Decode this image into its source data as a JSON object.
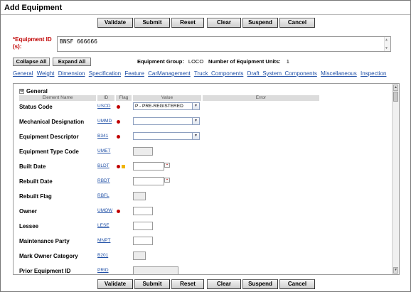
{
  "window": {
    "title": "Add Equipment"
  },
  "toolbar": {
    "validate": "Validate",
    "submit": "Submit",
    "reset": "Reset",
    "clear": "Clear",
    "suspend": "Suspend",
    "cancel": "Cancel"
  },
  "equipment_id": {
    "label_line1": "*Equipment ID",
    "label_line2": "(s):",
    "value": "BNSF 666666"
  },
  "controls": {
    "collapse_all": "Collapse All",
    "expand_all": "Expand All",
    "equipment_group_label": "Equipment Group:",
    "equipment_group_value": "LOCO",
    "units_label": "Number of Equipment Units:",
    "units_value": "1"
  },
  "section_links": [
    "General",
    "Weight",
    "Dimension",
    "Specification",
    "Feature",
    "CarManagement",
    "Truck_Components",
    "Draft_System_Components",
    "Miscellaneous",
    "Inspection"
  ],
  "section": {
    "toggle_symbol": "⊖",
    "title": "General",
    "columns": {
      "element": "Element Name",
      "id": "ID",
      "flag": "Flag",
      "value": "Value",
      "error": "Error"
    }
  },
  "rows": [
    {
      "label": "Status Code",
      "id": "USCD",
      "value": "P - PRE-REGISTERED"
    },
    {
      "label": "Mechanical Designation",
      "id": "UMMD",
      "value": ""
    },
    {
      "label": "Equipment Descriptor",
      "id": "B341",
      "value": ""
    },
    {
      "label": "Equipment Type Code",
      "id": "UMET",
      "value": ""
    },
    {
      "label": "Built Date",
      "id": "BLDT",
      "value": ""
    },
    {
      "label": "Rebuilt Date",
      "id": "RBDT",
      "value": ""
    },
    {
      "label": "Rebuilt Flag",
      "id": "RBFL",
      "value": ""
    },
    {
      "label": "Owner",
      "id": "UMOW",
      "value": ""
    },
    {
      "label": "Lessee",
      "id": "LESE",
      "value": ""
    },
    {
      "label": "Maintenance Party",
      "id": "MNPT",
      "value": ""
    },
    {
      "label": "Mark Owner Category",
      "id": "B201",
      "value": ""
    },
    {
      "label": "Prior Equipment ID",
      "id": "PRID",
      "value": ""
    }
  ],
  "icons": {
    "required_flag": "red-dot-icon",
    "warning_flag": "yellow-square-icon",
    "calendar": "calendar-icon",
    "dropdown": "chevron-down-icon"
  },
  "colors": {
    "link": "#1f4fa6",
    "required": "#c00000",
    "warning": "#f0b400"
  }
}
